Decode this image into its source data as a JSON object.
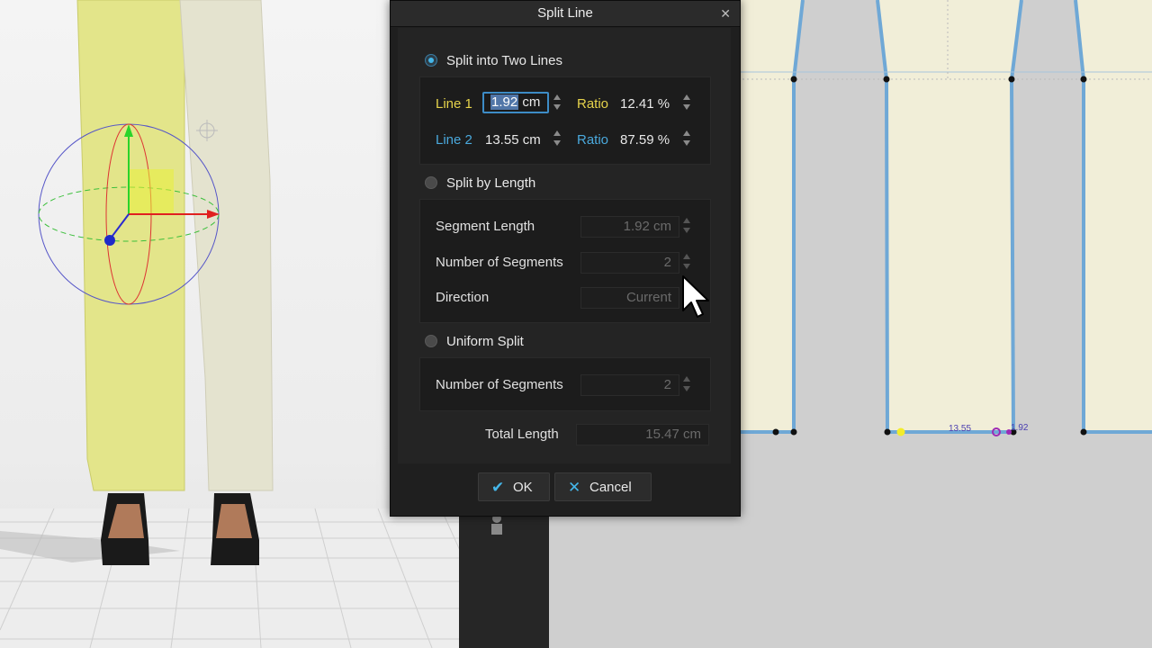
{
  "dialog": {
    "title": "Split Line",
    "close_icon": "close-icon",
    "split_two_lines": {
      "label": "Split into Two Lines",
      "selected": true,
      "line1_label": "Line 1",
      "line1_value_selected": "1.92",
      "line1_unit": " cm",
      "ratio1_label": "Ratio",
      "ratio1_value": "12.41 %",
      "line2_label": "Line 2",
      "line2_value": "13.55 cm",
      "ratio2_label": "Ratio",
      "ratio2_value": "87.59 %"
    },
    "split_by_length": {
      "label": "Split by Length",
      "selected": false,
      "segment_length_label": "Segment Length",
      "segment_length_value": "1.92 cm",
      "num_segments_label": "Number of Segments",
      "num_segments_value": "2",
      "direction_label": "Direction",
      "direction_value": "Current"
    },
    "uniform_split": {
      "label": "Uniform Split",
      "selected": false,
      "num_segments_label": "Number of Segments",
      "num_segments_value": "2"
    },
    "total_length_label": "Total Length",
    "total_length_value": "15.47 cm",
    "ok_label": "OK",
    "cancel_label": "Cancel"
  },
  "pattern": {
    "measure_left": "13.55",
    "measure_right": "1.92"
  },
  "colors": {
    "accent_blue": "#45b7ea",
    "line1_yellow": "#e6d34b",
    "line2_blue": "#4aa9dd",
    "pattern_fill": "#f1eed8",
    "pattern_outline": "#6fa8d6"
  }
}
